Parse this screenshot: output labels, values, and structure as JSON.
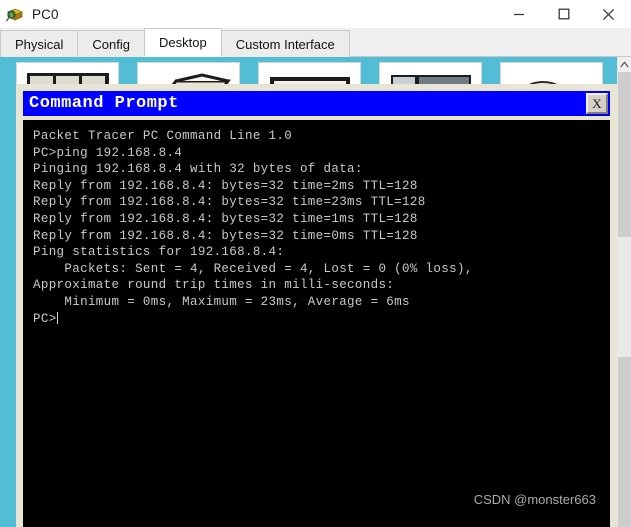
{
  "window": {
    "title": "PC0",
    "icon": "packet-tracer-icon",
    "controls": {
      "minimize": "minimize-icon",
      "maximize": "maximize-icon",
      "close": "close-icon"
    }
  },
  "tabs": [
    {
      "label": "Physical",
      "active": false
    },
    {
      "label": "Config",
      "active": false
    },
    {
      "label": "Desktop",
      "active": true
    },
    {
      "label": "Custom Interface",
      "active": false
    }
  ],
  "desktop": {
    "background_color": "#54bdd6",
    "icon_tiles": [
      {
        "name": "ip-configuration-tile"
      },
      {
        "name": "dial-up-tile"
      },
      {
        "name": "terminal-tile"
      },
      {
        "name": "command-prompt-tile"
      },
      {
        "name": "web-browser-tile"
      }
    ]
  },
  "scrollbar": {
    "up_arrow": "chevron-up-icon"
  },
  "command_prompt": {
    "title": "Command Prompt",
    "close_label": "X",
    "title_bar_color": "#0000ff",
    "terminal_bg": "#000000",
    "terminal_fg": "#c9c9c9",
    "lines": [
      "",
      "Packet Tracer PC Command Line 1.0",
      "PC>ping 192.168.8.4",
      "",
      "Pinging 192.168.8.4 with 32 bytes of data:",
      "",
      "Reply from 192.168.8.4: bytes=32 time=2ms TTL=128",
      "Reply from 192.168.8.4: bytes=32 time=23ms TTL=128",
      "Reply from 192.168.8.4: bytes=32 time=1ms TTL=128",
      "Reply from 192.168.8.4: bytes=32 time=0ms TTL=128",
      "",
      "Ping statistics for 192.168.8.4:",
      "    Packets: Sent = 4, Received = 4, Lost = 0 (0% loss),",
      "Approximate round trip times in milli-seconds:",
      "    Minimum = 0ms, Maximum = 23ms, Average = 6ms",
      ""
    ],
    "prompt": "PC>"
  },
  "watermark": {
    "text": "CSDN @monster663"
  }
}
